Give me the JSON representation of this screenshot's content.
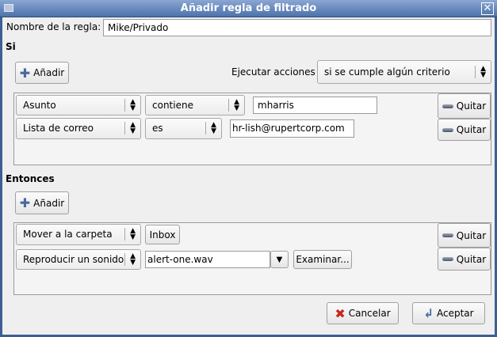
{
  "window": {
    "title": "Añadir regla de filtrado"
  },
  "rule_name": {
    "label": "Nombre de la regla:",
    "value": "Mike/Privado"
  },
  "if_section": {
    "heading": "Si",
    "add_label": "Añadir",
    "execute_label": "Ejecutar acciones",
    "execute_value": "si se cumple algún criterio",
    "criteria": [
      {
        "field": "Asunto",
        "operator": "contiene",
        "value": "mharris",
        "remove_label": "Quitar"
      },
      {
        "field": "Lista de correo",
        "operator": "es",
        "value": "hr-lish@rupertcorp.com",
        "remove_label": "Quitar"
      }
    ]
  },
  "then_section": {
    "heading": "Entonces",
    "add_label": "Añadir",
    "actions": [
      {
        "action": "Mover a la carpeta",
        "folder": "Inbox",
        "remove_label": "Quitar"
      },
      {
        "action": "Reproducir un sonido",
        "sound_file": "alert-one.wav",
        "browse_label": "Examinar...",
        "remove_label": "Quitar"
      }
    ]
  },
  "footer": {
    "cancel_label": "Cancelar",
    "ok_label": "Aceptar"
  }
}
